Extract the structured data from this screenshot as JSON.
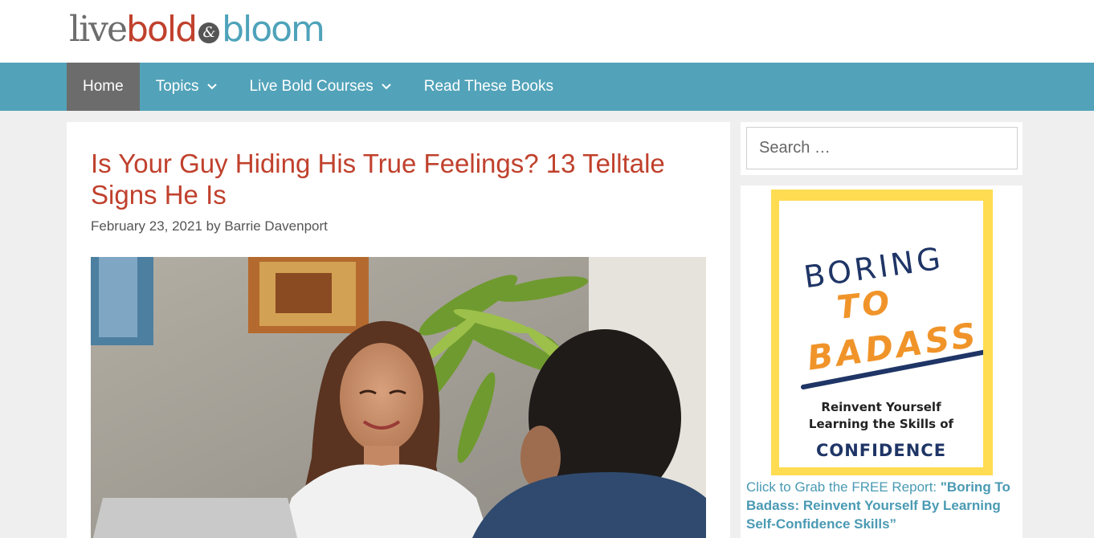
{
  "logo": {
    "part1": "live",
    "part2": "bold",
    "amp": "&",
    "part3": "bloom"
  },
  "nav": {
    "items": [
      {
        "label": "Home",
        "dropdown": false,
        "active": true
      },
      {
        "label": "Topics",
        "dropdown": true,
        "active": false
      },
      {
        "label": "Live Bold Courses",
        "dropdown": true,
        "active": false
      },
      {
        "label": "Read These Books",
        "dropdown": false,
        "active": false
      }
    ]
  },
  "article": {
    "title": "Is Your Guy Hiding His True Feelings? 13 Telltale Signs He Is",
    "date": "February 23, 2021",
    "by": "by",
    "author": "Barrie Davenport"
  },
  "sidebar": {
    "search": {
      "placeholder": "Search …"
    },
    "promo": {
      "cover": {
        "line1": "BORING",
        "line2": "TO",
        "line3": "BADASS",
        "subtitle1": "Reinvent Yourself",
        "subtitle2": "Learning the Skills of",
        "subtitle3": "CONFIDENCE"
      },
      "caption_lead": "Click to Grab the FREE Report: ",
      "caption_bold": "\"Boring To Badass: Reinvent Yourself By Learning Self-Confidence Skills”"
    }
  },
  "colors": {
    "brand_red": "#c0412d",
    "brand_teal": "#52a3b9",
    "nav_active": "#6c6c6c",
    "cover_yellow": "#ffdc52",
    "cover_orange": "#f0942a",
    "cover_navy": "#1f3566"
  }
}
